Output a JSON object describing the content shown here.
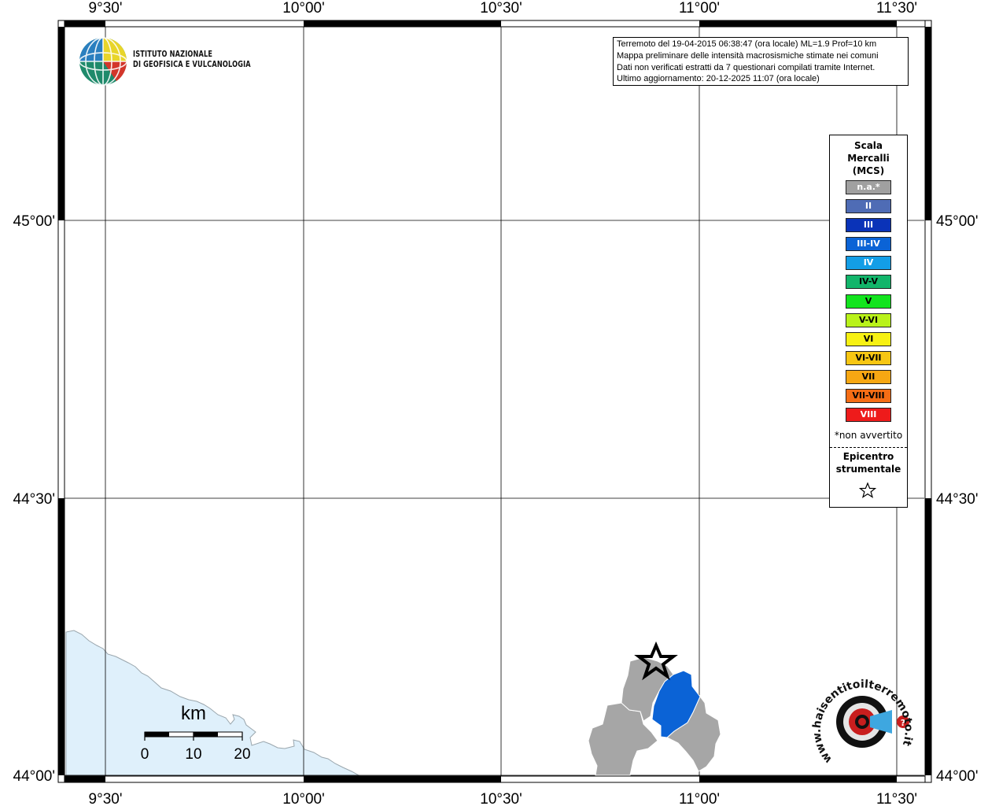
{
  "axes": {
    "top_labels": [
      "9°30'",
      "10°00'",
      "10°30'",
      "11°00'",
      "11°30'"
    ],
    "bottom_labels": [
      "9°30'",
      "10°00'",
      "10°30'",
      "11°00'",
      "11°30'"
    ],
    "left_labels": [
      "45°00'",
      "44°30'",
      "44°00'"
    ],
    "right_labels": [
      "45°00'",
      "44°30'",
      "44°00'"
    ]
  },
  "logo": {
    "line1": "ISTITUTO NAZIONALE",
    "line2": "DI GEOFISICA E VULCANOLOGIA"
  },
  "info": {
    "line1": "Terremoto del 19-04-2015 06:38:47 (ora locale) ML=1.9 Prof=10 km",
    "line2": "Mappa preliminare delle intensità macrosismiche stimate nei comuni",
    "line3": "Dati non verificati estratti da 7 questionari compilati tramite Internet.",
    "line4": "Ultimo aggiornamento: 20-12-2025 11:07 (ora locale)"
  },
  "legend": {
    "title_line1": "Scala",
    "title_line2": "Mercalli",
    "title_line3": "(MCS)",
    "items": [
      {
        "label": "n.a.*",
        "color": "#a0a0a0",
        "text_color": "#ffffff"
      },
      {
        "label": "II",
        "color": "#4f6cb5",
        "text_color": "#ffffff"
      },
      {
        "label": "III",
        "color": "#0a33b8",
        "text_color": "#ffffff"
      },
      {
        "label": "III-IV",
        "color": "#0b63d6",
        "text_color": "#ffffff"
      },
      {
        "label": "IV",
        "color": "#139ee6",
        "text_color": "#ffffff"
      },
      {
        "label": "IV-V",
        "color": "#12b56a",
        "text_color": "#000000"
      },
      {
        "label": "V",
        "color": "#12e41e",
        "text_color": "#000000"
      },
      {
        "label": "V-VI",
        "color": "#b9f21a",
        "text_color": "#000000"
      },
      {
        "label": "VI",
        "color": "#f7f113",
        "text_color": "#000000"
      },
      {
        "label": "VI-VII",
        "color": "#f7c613",
        "text_color": "#000000"
      },
      {
        "label": "VII",
        "color": "#f7a713",
        "text_color": "#000000"
      },
      {
        "label": "VII-VIII",
        "color": "#f56d15",
        "text_color": "#000000"
      },
      {
        "label": "VIII",
        "color": "#ee1b1b",
        "text_color": "#ffffff"
      }
    ],
    "note": "*non avvertito",
    "epicenter_line1": "Epicentro",
    "epicenter_line2": "strumentale"
  },
  "scalebar": {
    "unit": "km",
    "labels": [
      "0",
      "10",
      "20"
    ]
  },
  "colors": {
    "sea": "#dff0fb",
    "municipality_na": "#a6a6a6",
    "municipality_intensity": "#0b63d6"
  },
  "watermark": {
    "text": "www.haisentitoilterremoto.it"
  }
}
